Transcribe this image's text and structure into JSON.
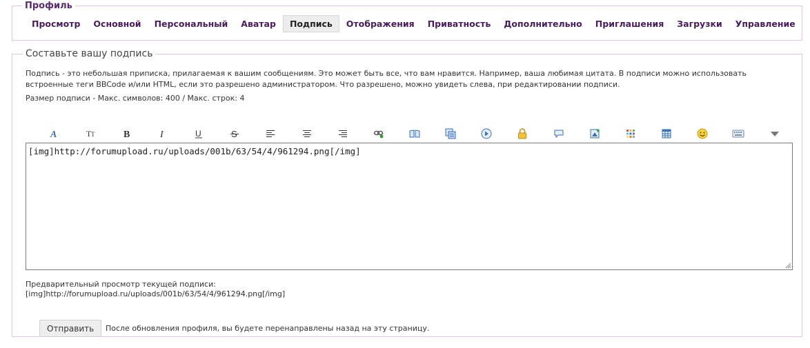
{
  "profile": {
    "legend": "Профиль",
    "tabs": [
      {
        "label": "Просмотр",
        "active": false
      },
      {
        "label": "Основной",
        "active": false
      },
      {
        "label": "Персональный",
        "active": false
      },
      {
        "label": "Аватар",
        "active": false
      },
      {
        "label": "Подпись",
        "active": true
      },
      {
        "label": "Отображения",
        "active": false
      },
      {
        "label": "Приватность",
        "active": false
      },
      {
        "label": "Дополнительно",
        "active": false
      },
      {
        "label": "Приглашения",
        "active": false
      },
      {
        "label": "Загрузки",
        "active": false
      },
      {
        "label": "Управление",
        "active": false
      }
    ]
  },
  "signature": {
    "legend": "Составьте вашу подпись",
    "description": "Подпись - это небольшая приписка, прилагаемая к вашим сообщениям. Это может быть все, что вам нравится. Например, ваша любимая цитата. В подписи можно использовать встроенные теги BBCode и/или HTML, если это разрешено администратором. Что разрешено, можно увидеть слева, при редактировании подписи.",
    "limits": "Размер подписи - Макс. символов: 400 / Макс. строк: 4",
    "editor_value": "[img]http://forumupload.ru/uploads/001b/63/54/4/961294.png[/img]",
    "preview_label": "Предварительный просмотр текущей подписи:",
    "preview_text": "[img]http://forumupload.ru/uploads/001b/63/54/4/961294.png[/img]",
    "submit_label": "Отправить",
    "redirect_note": "После обновления профиля, вы будете перенаправлены назад на эту страницу."
  },
  "toolbar": {
    "buttons": [
      "font-icon",
      "font-size-icon",
      "bold-icon",
      "italic-icon",
      "underline-icon",
      "strikethrough-icon",
      "align-left-icon",
      "align-center-icon",
      "align-right-icon",
      "link-icon",
      "quote-icon",
      "code-icon",
      "video-icon",
      "hide-icon",
      "speech-bubble-icon",
      "image-icon",
      "color-palette-icon",
      "table-icon",
      "smiley-icon",
      "keyboard-icon",
      "more-dropdown-icon"
    ]
  },
  "colors": {
    "accent": "#4a1c5e",
    "border": "#e9c2e9",
    "icon_blue": "#3b6fb6"
  }
}
